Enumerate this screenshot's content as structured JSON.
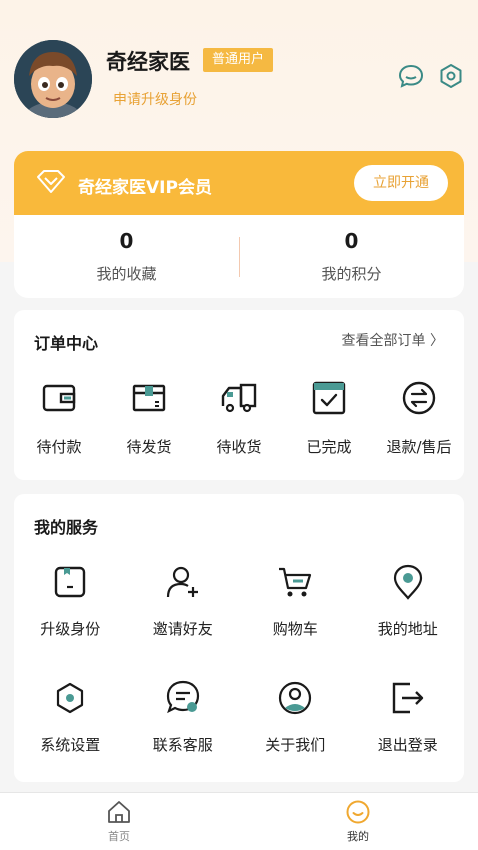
{
  "user": {
    "name": "奇经家医",
    "badge": "普通用户",
    "upgrade_link": "申请升级身份"
  },
  "vip": {
    "title": "奇经家医VIP会员",
    "button": "立即开通"
  },
  "stats": [
    {
      "value": "0",
      "label": "我的收藏"
    },
    {
      "value": "0",
      "label": "我的积分"
    }
  ],
  "orders": {
    "title": "订单中心",
    "view_all": "查看全部订单 〉",
    "items": [
      {
        "label": "待付款",
        "icon": "wallet-icon"
      },
      {
        "label": "待发货",
        "icon": "package-icon"
      },
      {
        "label": "待收货",
        "icon": "truck-icon"
      },
      {
        "label": "已完成",
        "icon": "check-box-icon"
      },
      {
        "label": "退款/售后",
        "icon": "refund-icon"
      }
    ]
  },
  "services": {
    "title": "我的服务",
    "items": [
      {
        "label": "升级身份",
        "icon": "upgrade-icon"
      },
      {
        "label": "邀请好友",
        "icon": "add-user-icon"
      },
      {
        "label": "购物车",
        "icon": "cart-icon"
      },
      {
        "label": "我的地址",
        "icon": "location-icon"
      },
      {
        "label": "系统设置",
        "icon": "settings-icon"
      },
      {
        "label": "联系客服",
        "icon": "chat-service-icon"
      },
      {
        "label": "关于我们",
        "icon": "about-user-icon"
      },
      {
        "label": "退出登录",
        "icon": "logout-icon"
      }
    ]
  },
  "nav": [
    {
      "label": "首页",
      "icon": "home-icon"
    },
    {
      "label": "我的",
      "icon": "smile-icon"
    }
  ],
  "colors": {
    "accent": "#f9b93b",
    "accent_text": "#e8a235",
    "teal": "#4a9a94"
  }
}
